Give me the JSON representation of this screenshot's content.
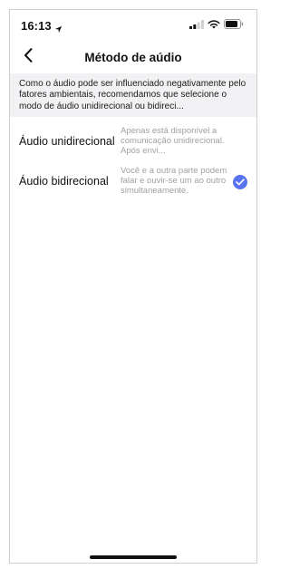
{
  "status_bar": {
    "time": "16:13",
    "icons": [
      "location-arrow-icon",
      "signal-icon",
      "wifi-icon",
      "battery-icon"
    ]
  },
  "nav": {
    "back_icon": "chevron-left-icon",
    "title": "Método de aúdio"
  },
  "info": {
    "text": "Como o áudio pode ser influenciado negativamente pelo fatores ambientais, recomendamos que selecione o modo de áudio unidirecional ou bidireci..."
  },
  "options": [
    {
      "label": "Áudio unidirecional",
      "description": "Apenas está disponível a comunicação unidirecional. Após envi...",
      "selected": false
    },
    {
      "label": "Áudio bidirecional",
      "description": "Você e a outra parte podem falar e ouvir-se um ao outro simultaneamente.",
      "selected": true
    }
  ],
  "colors": {
    "accent": "#5a73f0",
    "banner_bg": "#f2f2f4",
    "description_text": "#a0a0a6"
  }
}
